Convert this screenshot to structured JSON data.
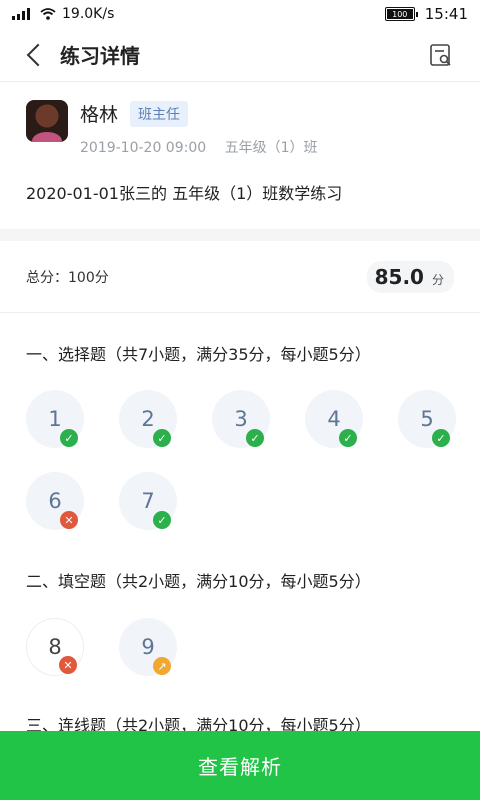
{
  "status_bar": {
    "net_speed": "19.0K/s",
    "battery": "100",
    "time": "15:41"
  },
  "nav": {
    "title": "练习详情"
  },
  "teacher": {
    "name": "格林",
    "role": "班主任",
    "datetime": "2019-10-20 09:00",
    "class_name": "五年级（1）班"
  },
  "assignment": {
    "title": "2020-01-01张三的 五年级（1）班数学练习"
  },
  "score": {
    "total_label": "总分：100分",
    "value": "85.0",
    "unit": "分"
  },
  "sections": [
    {
      "title": "一、选择题（共7小题，满分35分，每小题5分）",
      "questions": [
        {
          "num": "1",
          "status": "correct"
        },
        {
          "num": "2",
          "status": "correct"
        },
        {
          "num": "3",
          "status": "correct"
        },
        {
          "num": "4",
          "status": "correct"
        },
        {
          "num": "5",
          "status": "correct"
        },
        {
          "num": "6",
          "status": "wrong"
        },
        {
          "num": "7",
          "status": "correct"
        }
      ]
    },
    {
      "title": "二、填空题（共2小题，满分10分，每小题5分）",
      "questions": [
        {
          "num": "8",
          "status": "wrong"
        },
        {
          "num": "9",
          "status": "partial"
        }
      ]
    },
    {
      "title": "三、连线题（共2小题，满分10分，每小题5分）"
    }
  ],
  "bottom": {
    "button_label": "查看解析"
  },
  "colors": {
    "correct": "#2bb04c",
    "wrong": "#e0593c",
    "partial": "#f0a830",
    "primary": "#22c447"
  }
}
